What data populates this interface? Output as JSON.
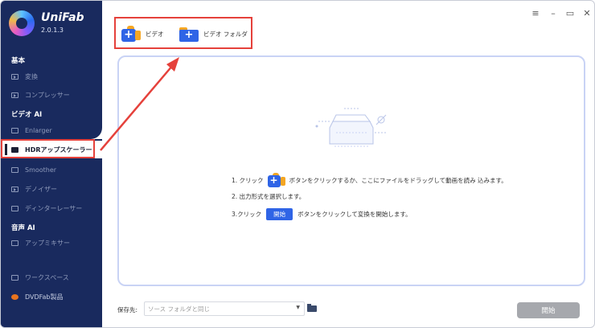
{
  "app": {
    "name": "UniFab",
    "version": "2.0.1.3"
  },
  "sidebar": {
    "sections": [
      {
        "title": "基本"
      },
      {
        "title": "ビデオ AI"
      },
      {
        "title": "音声 AI"
      }
    ],
    "items": [
      {
        "label": "変換",
        "icon": "play-icon"
      },
      {
        "label": "コンプレッサー",
        "icon": "play-icon"
      },
      {
        "label": "Enlarger",
        "icon": "enlarge-icon"
      },
      {
        "label": "HDRアップスケーラー",
        "icon": "hdr-icon",
        "active": true
      },
      {
        "label": "Smoother",
        "icon": "smoother-icon"
      },
      {
        "label": "デノイザー",
        "icon": "denoise-icon"
      },
      {
        "label": "ディンターレーサー",
        "icon": "deinterlace-icon"
      },
      {
        "label": "アップミキサー",
        "icon": "upmix-icon"
      },
      {
        "label": "ワークスペース",
        "icon": "monitor-icon"
      },
      {
        "label": "DVDFab製品",
        "icon": "dvdfab-icon"
      }
    ]
  },
  "toolbar": {
    "video_label": "ビデオ",
    "video_folder_label": "ビデオ フォルダ"
  },
  "instructions": {
    "step1_prefix": "1. クリック",
    "step1_suffix": "ボタンをクリックするか、ここにファイルをドラッグして動画を読み 込みます。",
    "step2": "2. 出力形式を選択します。",
    "step3_prefix": "3.クリック",
    "step3_chip": "開始",
    "step3_suffix": "ボタンをクリックして変換を開始します。"
  },
  "bottom": {
    "save_label": "保存先:",
    "save_value": "ソース フォルダと同じ",
    "start_label": "開始"
  },
  "colors": {
    "sidebar": "#192a5e",
    "accent": "#2f64e6",
    "highlight": "#e5413b",
    "start_disabled": "#a6a8ad"
  }
}
